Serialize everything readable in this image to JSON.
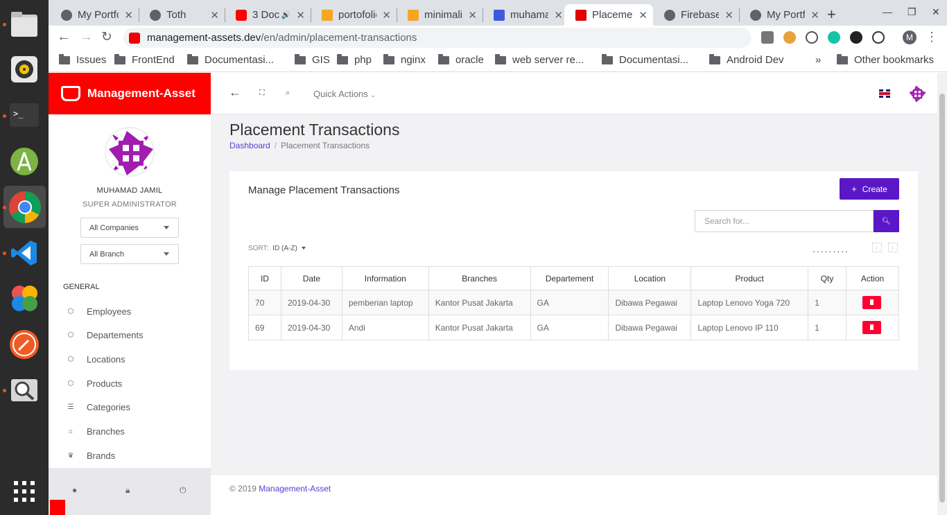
{
  "browser": {
    "tabs": [
      {
        "label": "My Portfolio",
        "favicon_color": "#5f6368"
      },
      {
        "label": "Toth",
        "favicon_color": "#5f6368"
      },
      {
        "label": "3 Doc",
        "favicon_color": "#ff0000"
      },
      {
        "label": "portofolio",
        "favicon_color": "#f5a623"
      },
      {
        "label": "minimalist",
        "favicon_color": "#f5a623"
      },
      {
        "label": "muhamad",
        "favicon_color": "#3b5bdb"
      },
      {
        "label": "Placement",
        "favicon_color": "#e00000"
      },
      {
        "label": "Firebase",
        "favicon_color": "#5f6368"
      },
      {
        "label": "My Portfolio",
        "favicon_color": "#5f6368"
      }
    ],
    "url_host": "management-assets.dev",
    "url_path": "/en/admin/placement-transactions",
    "profile_initial": "M",
    "bookmarks": [
      "Issues",
      "FrontEnd",
      "Documentasi...",
      "GIS",
      "php",
      "nginx",
      "oracle",
      "web server re...",
      "Documentasi...",
      "Android Dev"
    ],
    "bookmarks_more": "»",
    "other_bookmarks": "Other bookmarks"
  },
  "app": {
    "brand": "Management-Asset",
    "user": {
      "name": "MUHAMAD JAMIL",
      "role": "SUPER ADMINISTRATOR"
    },
    "company_select": "All Companies",
    "branch_select": "All Branch",
    "nav_section": "GENERAL",
    "nav_items": [
      {
        "label": "Employees",
        "icon": "cube-icon"
      },
      {
        "label": "Departements",
        "icon": "cube-icon"
      },
      {
        "label": "Locations",
        "icon": "cube-icon"
      },
      {
        "label": "Products",
        "icon": "cube-icon"
      },
      {
        "label": "Categories",
        "icon": "list-icon"
      },
      {
        "label": "Branches",
        "icon": "home-icon"
      },
      {
        "label": "Brands",
        "icon": "crown-icon"
      }
    ],
    "quick_actions": "Quick Actions",
    "accent": "#5a17c7",
    "brand_color": "#ff0000"
  },
  "page": {
    "title": "Placement Transactions",
    "breadcrumb_home": "Dashboard",
    "breadcrumb_current": "Placement Transactions",
    "card_title": "Manage Placement Transactions",
    "create_label": "Create",
    "search_placeholder": "Search for...",
    "sort_label": "SORT:",
    "sort_value": "ID (A-Z)",
    "pager_dots": ".........",
    "columns": [
      "ID",
      "Date",
      "Information",
      "Branches",
      "Departement",
      "Location",
      "Product",
      "Qty",
      "Action"
    ],
    "rows": [
      [
        "70",
        "2019-04-30",
        "pemberian laptop",
        "Kantor Pusat Jakarta",
        "GA",
        "Dibawa Pegawai",
        "Laptop Lenovo Yoga 720",
        "1"
      ],
      [
        "69",
        "2019-04-30",
        "Andi",
        "Kantor Pusat Jakarta",
        "GA",
        "Dibawa Pegawai",
        "Laptop Lenovo IP 110",
        "1"
      ]
    ],
    "footer_copy": "© 2019",
    "footer_link": "Management-Asset"
  }
}
